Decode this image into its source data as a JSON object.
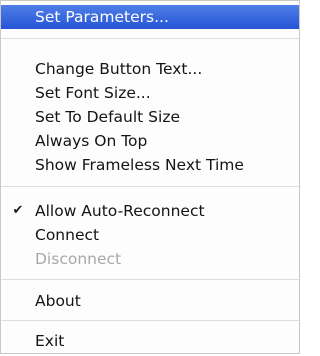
{
  "menu": {
    "items": [
      {
        "label": "Set Parameters..."
      },
      {
        "label": "Change Button Text..."
      },
      {
        "label": "Set Font Size..."
      },
      {
        "label": "Set To Default Size"
      },
      {
        "label": "Always On Top"
      },
      {
        "label": "Show Frameless Next Time"
      },
      {
        "label": "Allow Auto-Reconnect",
        "checked": true
      },
      {
        "label": "Connect"
      },
      {
        "label": "Disconnect",
        "enabled": false
      },
      {
        "label": "About"
      },
      {
        "label": "Exit"
      }
    ],
    "highlighted_item": "Set Parameters...",
    "check_glyph": "✔"
  }
}
